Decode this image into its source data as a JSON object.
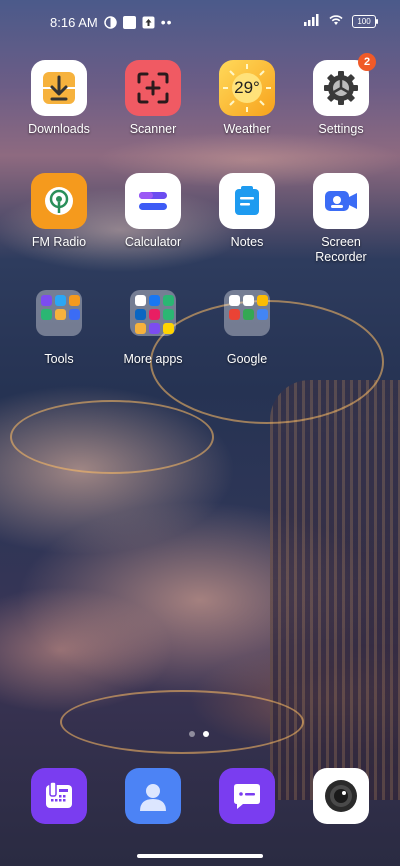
{
  "status_bar": {
    "time": "8:16 AM",
    "battery": "100"
  },
  "apps": {
    "downloads": {
      "label": "Downloads",
      "color": "#f6b23d"
    },
    "scanner": {
      "label": "Scanner",
      "color": "#f05a63"
    },
    "weather": {
      "label": "Weather",
      "temperature": "29°",
      "color": "#f7b52c"
    },
    "settings": {
      "label": "Settings",
      "badge": "2",
      "color": "#ffffff"
    },
    "fm_radio": {
      "label": "FM Radio",
      "color": "#f59a1d"
    },
    "calculator": {
      "label": "Calculator",
      "color": "#ffffff"
    },
    "notes": {
      "label": "Notes",
      "color": "#ffffff"
    },
    "screen_recorder": {
      "label": "Screen\nRecorder",
      "color": "#ffffff"
    }
  },
  "folders": {
    "tools": {
      "label": "Tools"
    },
    "more_apps": {
      "label": "More apps"
    },
    "google": {
      "label": "Google"
    }
  },
  "dock": {
    "phone": "phone-icon",
    "contacts": "contacts-icon",
    "messages": "messages-icon",
    "camera": "camera-icon"
  }
}
